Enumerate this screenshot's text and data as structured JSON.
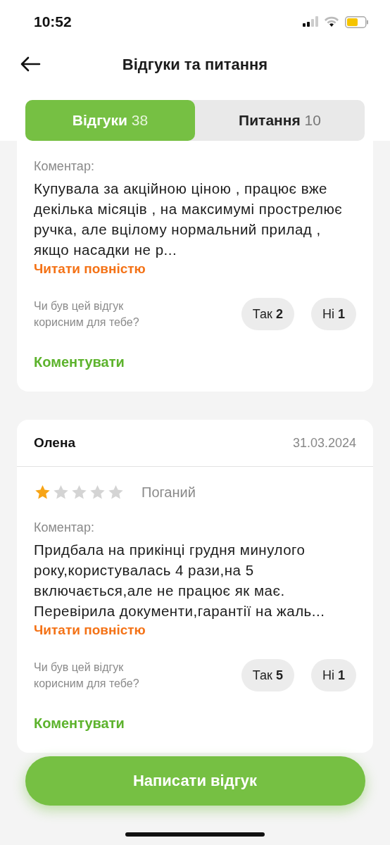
{
  "status_bar": {
    "time": "10:52"
  },
  "header": {
    "title": "Відгуки та питання"
  },
  "tabs": [
    {
      "label": "Відгуки",
      "count": "38",
      "selected": true
    },
    {
      "label": "Питання",
      "count": "10",
      "selected": false
    }
  ],
  "reviews": [
    {
      "comment_label": "Коментар:",
      "comment": "Купувала за акційною ціною , працює вже декілька місяців , на максимумі прострелює ручка, але вцілому нормальний прилад , якщо насадки не р...",
      "read_more": "Читати повністю",
      "helpful_question": "Чи був цей відгук корисним для тебе?",
      "votes": [
        {
          "label": "Так",
          "count": "2"
        },
        {
          "label": "Ні",
          "count": "1"
        }
      ],
      "comment_action": "Коментувати"
    },
    {
      "author": "Олена",
      "date": "31.03.2024",
      "stars": 1,
      "rating_label": "Поганий",
      "comment_label": "Коментар:",
      "comment": "Придбала на прикінці грудня минулого року,користувалась 4 рази,на 5 включається,але не працює як має. Перевірила документи,гарантії на жаль...",
      "read_more": "Читати повністю",
      "helpful_question": "Чи був цей відгук корисним для тебе?",
      "votes": [
        {
          "label": "Так",
          "count": "5"
        },
        {
          "label": "Ні",
          "count": "1"
        }
      ],
      "comment_action": "Коментувати"
    }
  ],
  "write_review_button": "Написати відгук"
}
